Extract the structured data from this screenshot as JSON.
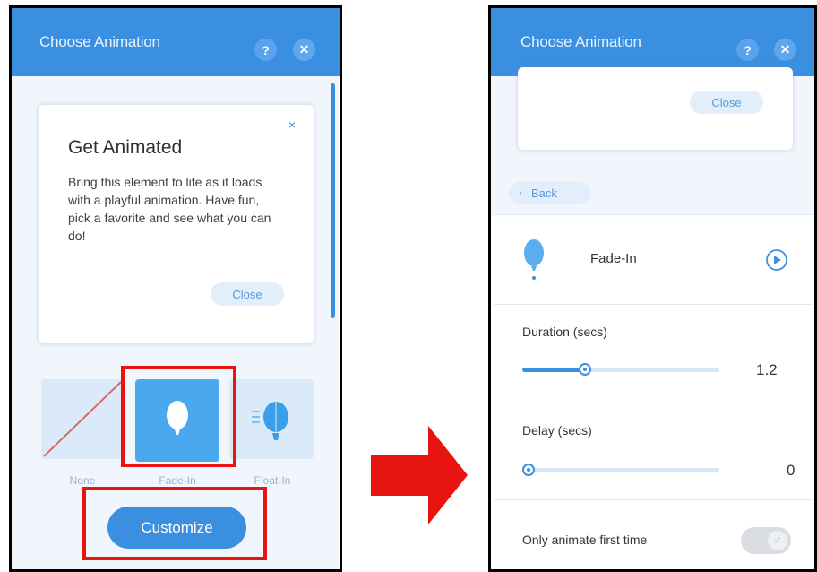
{
  "left_panel": {
    "title": "Choose Animation",
    "help_label": "?",
    "close_label": "✕",
    "card": {
      "close_x": "×",
      "title": "Get Animated",
      "body": "Bring this element to life as it loads with a playful animation. Have fun, pick a favorite and see what you can do!",
      "close_button": "Close"
    },
    "animations": [
      {
        "label": "None"
      },
      {
        "label": "Fade-In",
        "selected": true
      },
      {
        "label": "Float-In"
      }
    ],
    "customize_button": "Customize"
  },
  "right_panel": {
    "title": "Choose Animation",
    "help_label": "?",
    "close_label": "✕",
    "card_close_button": "Close",
    "back_button": "Back",
    "selected_animation": {
      "name": "Fade-In"
    },
    "duration": {
      "label": "Duration (secs)",
      "value": "1.2",
      "fraction": 0.32
    },
    "delay": {
      "label": "Delay (secs)",
      "value": "0",
      "fraction": 0.0
    },
    "only_first_time": {
      "label": "Only animate first time",
      "enabled": true
    }
  },
  "colors": {
    "accent": "#3b8fe0",
    "highlight": "#e8140f"
  }
}
